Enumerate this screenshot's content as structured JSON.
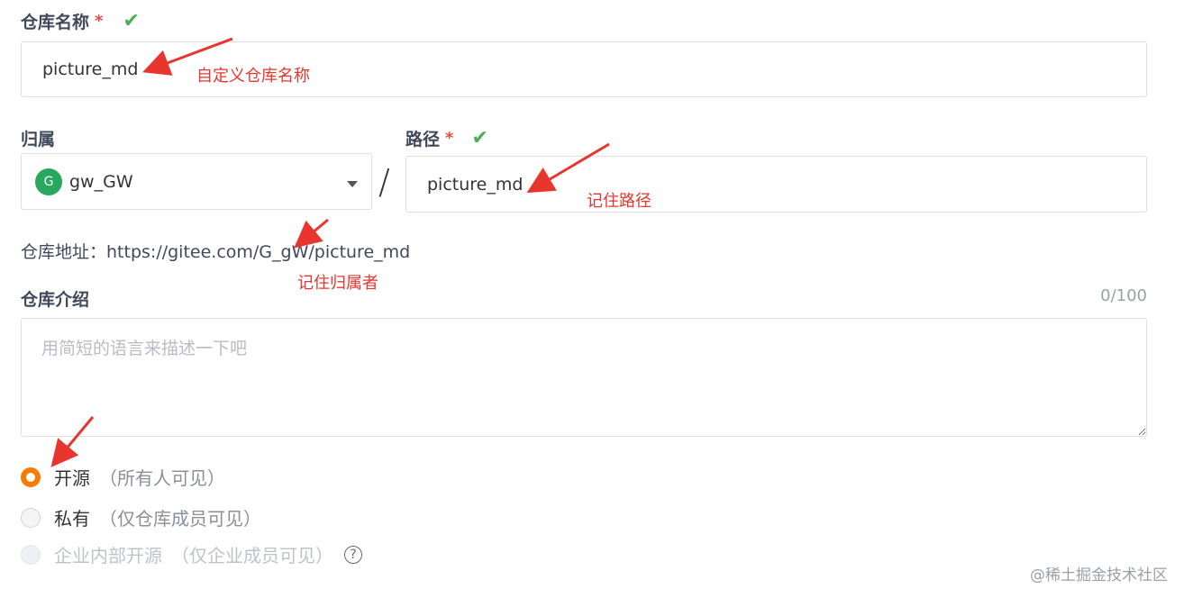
{
  "repo_name": {
    "label": "仓库名称",
    "required_mark": "*",
    "value": "picture_md",
    "annotation": "自定义仓库名称"
  },
  "owner": {
    "label": "归属",
    "avatar_letter": "G",
    "value": "gw_GW",
    "colors": {
      "avatar": "#26a95d"
    }
  },
  "separator": "/",
  "path": {
    "label": "路径",
    "required_mark": "*",
    "value": "picture_md",
    "annotation": "记住路径"
  },
  "repo_address": {
    "label": "仓库地址：",
    "url": "https://gitee.com/G_gW/picture_md",
    "annotation": "记住归属者"
  },
  "description": {
    "label": "仓库介绍",
    "counter": "0/100",
    "placeholder": "用简短的语言来描述一下吧"
  },
  "visibility": {
    "options": [
      {
        "label": "开源",
        "hint": "（所有人可见）",
        "selected": true,
        "disabled": false
      },
      {
        "label": "私有",
        "hint": "（仅仓库成员可见）",
        "selected": false,
        "disabled": false
      },
      {
        "label": "企业内部开源",
        "hint": "（仅企业成员可见）",
        "selected": false,
        "disabled": true
      }
    ],
    "help_glyph": "?"
  },
  "watermark": "@稀土掘金技术社区",
  "icons": {
    "check": "check-icon",
    "caret": "caret-down-icon",
    "help": "help-icon"
  },
  "colors": {
    "accent": "#f57c00",
    "annotation": "#e8362f",
    "valid": "#4caf50"
  }
}
